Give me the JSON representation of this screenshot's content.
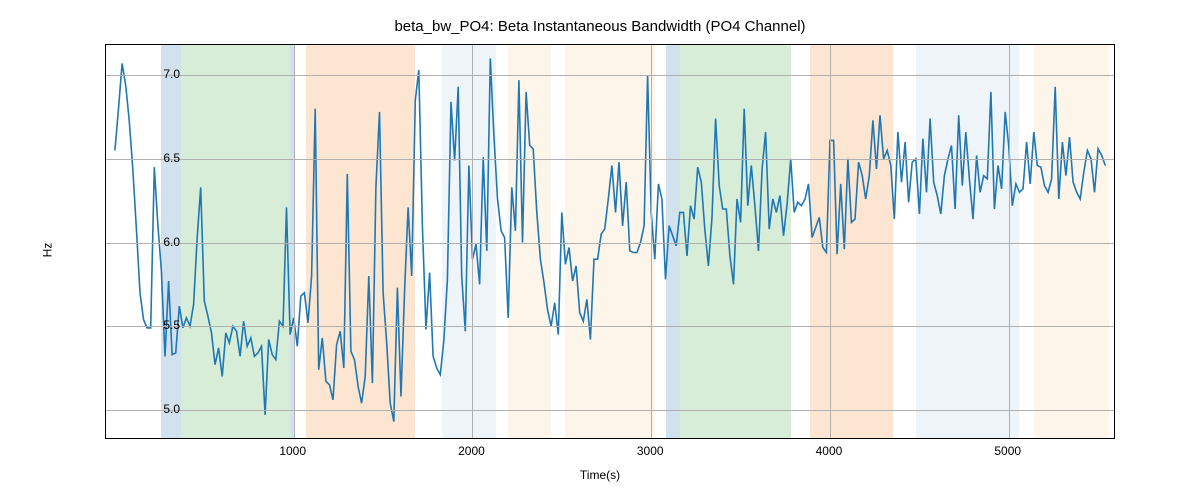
{
  "chart_data": {
    "type": "line",
    "title": "beta_bw_PO4: Beta Instantaneous Bandwidth (PO4 Channel)",
    "xlabel": "Time(s)",
    "ylabel": "Hz",
    "xlim": [
      -50,
      5600
    ],
    "ylim": [
      4.82,
      7.18
    ],
    "xticks": [
      1000,
      2000,
      3000,
      4000,
      5000
    ],
    "yticks": [
      5.0,
      5.5,
      6.0,
      6.5,
      7.0
    ],
    "grid": true,
    "background_regions": [
      {
        "x0": 260,
        "x1": 370,
        "color": "#5b93c1"
      },
      {
        "x0": 370,
        "x1": 980,
        "color": "#6fbf73"
      },
      {
        "x0": 980,
        "x1": 1010,
        "color": "#5b93c1"
      },
      {
        "x0": 1070,
        "x1": 1680,
        "color": "#f5a45a"
      },
      {
        "x0": 1830,
        "x1": 2130,
        "color": "#c7d7ea"
      },
      {
        "x0": 2200,
        "x1": 2440,
        "color": "#f7d6b5"
      },
      {
        "x0": 2520,
        "x1": 3020,
        "color": "#f7d6b5"
      },
      {
        "x0": 3080,
        "x1": 3160,
        "color": "#5b93c1"
      },
      {
        "x0": 3160,
        "x1": 3780,
        "color": "#6fbf73"
      },
      {
        "x0": 3890,
        "x1": 4350,
        "color": "#f5a45a"
      },
      {
        "x0": 4480,
        "x1": 5060,
        "color": "#c7d7ea"
      },
      {
        "x0": 5140,
        "x1": 5560,
        "color": "#f7d6b5"
      }
    ],
    "x": [
      0,
      20,
      40,
      60,
      80,
      100,
      120,
      140,
      160,
      180,
      200,
      220,
      240,
      260,
      280,
      300,
      320,
      340,
      360,
      380,
      400,
      420,
      440,
      460,
      480,
      500,
      520,
      540,
      560,
      580,
      600,
      620,
      640,
      660,
      680,
      700,
      720,
      740,
      760,
      780,
      800,
      820,
      840,
      860,
      880,
      900,
      920,
      940,
      960,
      980,
      1000,
      1020,
      1040,
      1060,
      1080,
      1100,
      1120,
      1140,
      1160,
      1180,
      1200,
      1220,
      1240,
      1260,
      1280,
      1300,
      1320,
      1340,
      1360,
      1380,
      1400,
      1420,
      1440,
      1460,
      1480,
      1500,
      1520,
      1540,
      1560,
      1580,
      1600,
      1620,
      1640,
      1660,
      1680,
      1700,
      1720,
      1740,
      1760,
      1780,
      1800,
      1820,
      1840,
      1860,
      1880,
      1900,
      1920,
      1940,
      1960,
      1980,
      2000,
      2020,
      2040,
      2060,
      2080,
      2100,
      2120,
      2140,
      2160,
      2180,
      2200,
      2220,
      2240,
      2260,
      2280,
      2300,
      2320,
      2340,
      2360,
      2380,
      2400,
      2420,
      2440,
      2460,
      2480,
      2500,
      2520,
      2540,
      2560,
      2580,
      2600,
      2620,
      2640,
      2660,
      2680,
      2700,
      2720,
      2740,
      2760,
      2780,
      2800,
      2820,
      2840,
      2860,
      2880,
      2900,
      2920,
      2940,
      2960,
      2980,
      3000,
      3020,
      3040,
      3060,
      3080,
      3100,
      3120,
      3140,
      3160,
      3180,
      3200,
      3220,
      3240,
      3260,
      3280,
      3300,
      3320,
      3340,
      3360,
      3380,
      3400,
      3420,
      3440,
      3460,
      3480,
      3500,
      3520,
      3540,
      3560,
      3580,
      3600,
      3620,
      3640,
      3660,
      3680,
      3700,
      3720,
      3740,
      3760,
      3780,
      3800,
      3820,
      3840,
      3860,
      3880,
      3900,
      3920,
      3940,
      3960,
      3980,
      4000,
      4020,
      4040,
      4060,
      4080,
      4100,
      4120,
      4140,
      4160,
      4180,
      4200,
      4220,
      4240,
      4260,
      4280,
      4300,
      4320,
      4340,
      4360,
      4380,
      4400,
      4420,
      4440,
      4460,
      4480,
      4500,
      4520,
      4540,
      4560,
      4580,
      4600,
      4620,
      4640,
      4660,
      4680,
      4700,
      4720,
      4740,
      4760,
      4780,
      4800,
      4820,
      4840,
      4860,
      4880,
      4900,
      4920,
      4940,
      4960,
      4980,
      5000,
      5020,
      5040,
      5060,
      5080,
      5100,
      5120,
      5140,
      5160,
      5180,
      5200,
      5220,
      5240,
      5260,
      5280,
      5300,
      5320,
      5340,
      5360,
      5380,
      5400,
      5420,
      5440,
      5460,
      5480,
      5500,
      5520,
      5540
    ],
    "values": [
      6.55,
      6.8,
      7.07,
      6.94,
      6.73,
      6.44,
      6.08,
      5.7,
      5.54,
      5.49,
      5.49,
      6.45,
      6.11,
      5.83,
      5.32,
      5.77,
      5.33,
      5.34,
      5.62,
      5.49,
      5.55,
      5.5,
      5.63,
      6.03,
      6.33,
      5.65,
      5.56,
      5.46,
      5.27,
      5.37,
      5.2,
      5.46,
      5.4,
      5.5,
      5.47,
      5.32,
      5.53,
      5.38,
      5.43,
      5.32,
      5.34,
      5.38,
      4.97,
      5.42,
      5.33,
      5.3,
      5.53,
      5.5,
      6.21,
      5.45,
      5.55,
      5.38,
      5.68,
      5.7,
      5.52,
      5.8,
      6.8,
      5.24,
      5.43,
      5.17,
      5.15,
      5.06,
      5.39,
      5.47,
      5.25,
      6.41,
      5.35,
      5.3,
      5.14,
      5.04,
      5.2,
      5.8,
      5.16,
      6.33,
      6.78,
      5.7,
      5.4,
      5.04,
      4.93,
      5.73,
      5.08,
      5.7,
      6.21,
      5.8,
      6.85,
      7.03,
      6.1,
      5.48,
      5.82,
      5.32,
      5.25,
      5.21,
      5.42,
      5.78,
      6.84,
      6.49,
      6.93,
      5.8,
      5.47,
      6.46,
      5.9,
      5.99,
      5.75,
      6.51,
      5.95,
      7.1,
      6.64,
      6.26,
      6.07,
      6.03,
      5.55,
      6.33,
      6.07,
      6.97,
      6.0,
      6.9,
      6.58,
      6.56,
      6.18,
      5.9,
      5.76,
      5.6,
      5.5,
      5.64,
      5.45,
      6.18,
      5.87,
      5.97,
      5.77,
      5.86,
      5.58,
      5.53,
      5.66,
      5.42,
      5.9,
      5.9,
      6.05,
      6.08,
      6.26,
      6.46,
      6.18,
      6.48,
      6.1,
      6.36,
      5.95,
      5.94,
      5.94,
      6.0,
      6.1,
      7.0,
      6.18,
      5.9,
      6.35,
      6.26,
      5.78,
      6.1,
      6.04,
      5.98,
      6.18,
      6.18,
      5.92,
      6.22,
      6.14,
      6.45,
      6.36,
      6.08,
      5.86,
      6.15,
      6.74,
      6.34,
      6.2,
      6.2,
      5.92,
      5.75,
      6.26,
      6.12,
      6.8,
      6.22,
      6.46,
      6.22,
      5.95,
      6.44,
      6.66,
      6.08,
      6.26,
      6.18,
      6.28,
      6.04,
      6.23,
      6.5,
      6.18,
      6.24,
      6.22,
      6.26,
      6.35,
      6.03,
      6.09,
      6.15,
      5.97,
      5.94,
      6.61,
      6.61,
      5.93,
      6.35,
      5.96,
      6.5,
      6.12,
      6.14,
      6.48,
      6.4,
      6.26,
      6.4,
      6.73,
      6.44,
      6.76,
      6.5,
      6.55,
      6.46,
      6.14,
      6.66,
      6.36,
      6.6,
      6.24,
      6.48,
      6.5,
      6.17,
      6.62,
      6.3,
      6.74,
      6.36,
      6.28,
      6.17,
      6.4,
      6.5,
      6.58,
      6.2,
      6.76,
      6.34,
      6.66,
      6.38,
      6.14,
      6.52,
      6.3,
      6.4,
      6.38,
      6.9,
      6.2,
      6.46,
      6.32,
      6.78,
      6.58,
      6.22,
      6.35,
      6.3,
      6.32,
      6.6,
      6.35,
      6.66,
      6.46,
      6.45,
      6.34,
      6.3,
      6.38,
      6.93,
      6.26,
      6.6,
      6.4,
      6.63,
      6.36,
      6.3,
      6.26,
      6.42,
      6.55,
      6.5,
      6.3,
      6.56,
      6.52,
      6.46
    ]
  }
}
